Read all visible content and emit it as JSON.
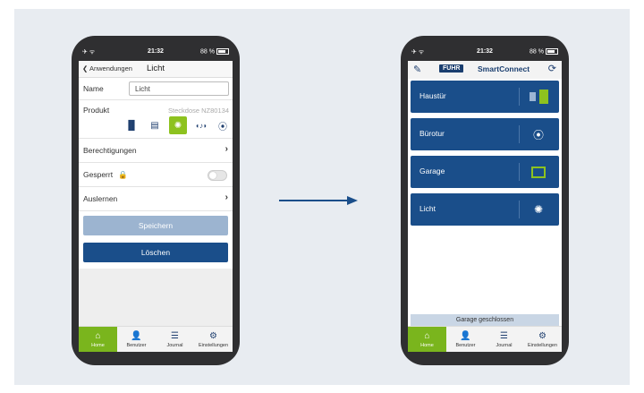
{
  "left_phone": {
    "status": {
      "time": "21:32",
      "battery": "88 %"
    },
    "nav": {
      "back_label": "Anwendungen",
      "title": "Licht"
    },
    "name_label": "Name",
    "name_value": "Licht",
    "product_label": "Produkt",
    "product_value": "Steckdose NZ80134",
    "icons": [
      "door-icon",
      "garage-icon",
      "bulb-icon",
      "bell-icon",
      "socket-icon"
    ],
    "selected_icon": "bulb-icon",
    "permissions_label": "Berechtigungen",
    "locked_label": "Gesperrt",
    "locked_toggle": "off",
    "learn_label": "Auslernen",
    "save_button": "Speichern",
    "delete_button": "Löschen",
    "tabs": [
      {
        "label": "Home",
        "icon": "home-icon"
      },
      {
        "label": "Benutzer",
        "icon": "user-icon"
      },
      {
        "label": "Journal",
        "icon": "list-icon"
      },
      {
        "label": "Einstellungen",
        "icon": "gear-icon"
      }
    ]
  },
  "right_phone": {
    "status": {
      "time": "21:32",
      "battery": "88 %"
    },
    "logo": "FUHR",
    "brand": "SmartConnect",
    "devices": [
      {
        "label": "Haustür",
        "icon": "door-icon"
      },
      {
        "label": "Bürotur",
        "icon": "socket-icon"
      },
      {
        "label": "Garage",
        "icon": "garage-icon"
      },
      {
        "label": "Licht",
        "icon": "bulb-icon"
      }
    ],
    "status_message": "Garage geschlossen",
    "tabs": [
      {
        "label": "Home",
        "icon": "home-icon"
      },
      {
        "label": "Benutzer",
        "icon": "user-icon"
      },
      {
        "label": "Journal",
        "icon": "list-icon"
      },
      {
        "label": "Einstellungen",
        "icon": "gear-icon"
      }
    ]
  },
  "colors": {
    "primary": "#1a4e8a",
    "accent_green": "#8dc21f",
    "save_disabled": "#9cb4d0",
    "background": "#e8ecf1"
  }
}
